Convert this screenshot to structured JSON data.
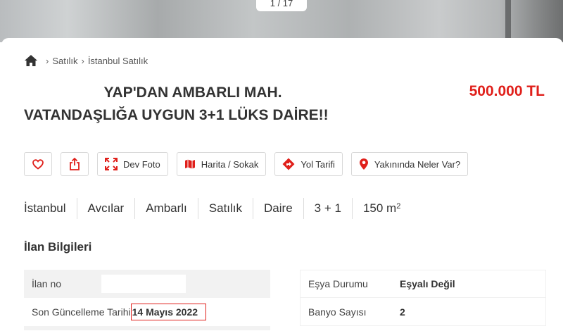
{
  "gallery": {
    "counter": "1 / 17"
  },
  "breadcrumb": {
    "items": [
      "Satılık",
      "İstanbul Satılık"
    ]
  },
  "listing": {
    "title_line1": "YAP'DAN AMBARLI MAH.",
    "title_line2": "VATANDAŞLIĞA UYGUN 3+1 LÜKS DAİRE!!",
    "price": "500.000 TL"
  },
  "actions": {
    "favorite_icon": "heart-icon",
    "share_icon": "share-icon",
    "big_photo": "Dev Foto",
    "map": "Harita / Sokak",
    "directions": "Yol Tarifi",
    "nearby": "Yakınında Neler Var?"
  },
  "tags": [
    "İstanbul",
    "Avcılar",
    "Ambarlı",
    "Satılık",
    "Daire",
    "3 + 1",
    "150 m"
  ],
  "area_unit_sup": "2",
  "info": {
    "section_title": "İlan Bilgileri",
    "left": [
      {
        "key": "İlan no",
        "value": ""
      },
      {
        "key": "Son Güncelleme Tarihi",
        "value": "14 Mayıs 2022"
      }
    ],
    "right": [
      {
        "key": "Eşya Durumu",
        "value": "Eşyalı Değil"
      },
      {
        "key": "Banyo Sayısı",
        "value": "2"
      }
    ]
  },
  "colors": {
    "accent_red": "#e0201b",
    "text": "#333333",
    "row_alt": "#f2f2f2"
  }
}
